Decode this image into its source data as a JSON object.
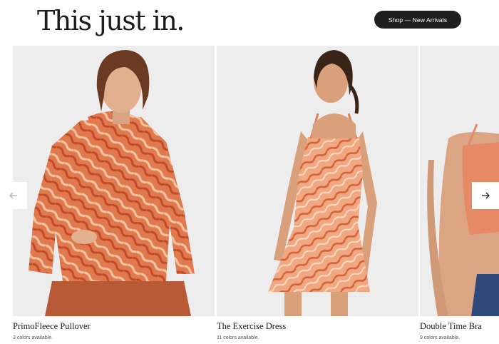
{
  "header": {
    "title": "This just in.",
    "cta_label": "Shop — New Arrivals"
  },
  "products": [
    {
      "name": "PrimoFleece Pullover",
      "colors": "3 colors available."
    },
    {
      "name": "The Exercise Dress",
      "colors": "11 colors available."
    },
    {
      "name": "Double Time Bra",
      "colors": "9 colors available."
    }
  ],
  "icons": {
    "prev": "arrow-left-icon",
    "next": "arrow-right-icon"
  },
  "colors": {
    "brand_dark": "#1f1f1f",
    "print_orange": "#d8643c",
    "print_peach": "#f0b08c"
  }
}
